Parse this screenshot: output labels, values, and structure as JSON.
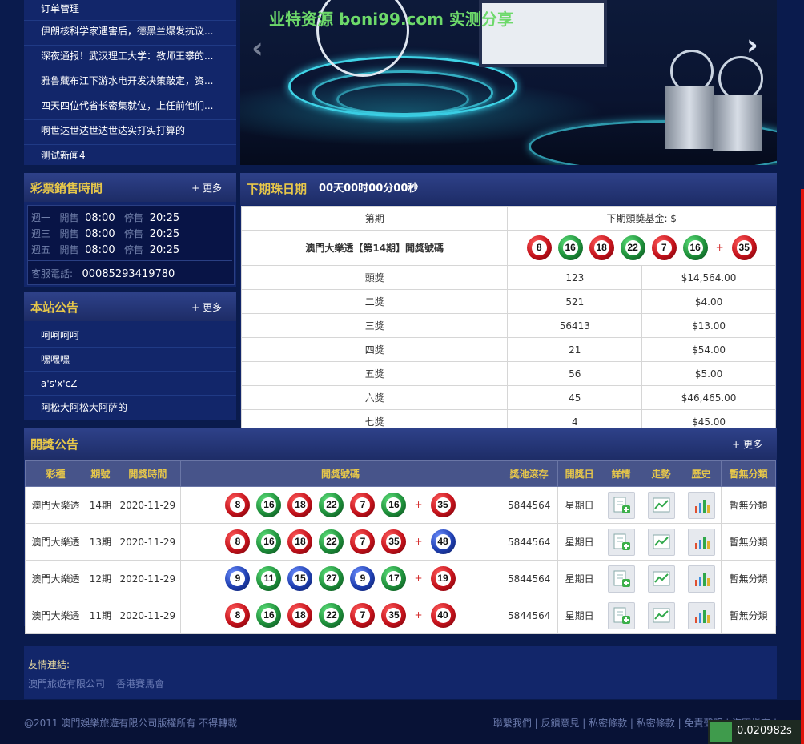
{
  "news": [
    "订单管理",
    "伊朗核科学家遇害后，德黑兰爆发抗议...",
    "深夜通报！武汉理工大学：教师王攀的...",
    "雅鲁藏布江下游水电开发决策敲定，资...",
    "四天四位代省长密集就位，上任前他们...",
    "啊世达世达世达世达实打实打算的",
    "测试新闻4"
  ],
  "banner": {
    "watermark": "业特资源 boni99.com 实测分享"
  },
  "sales": {
    "title": "彩票銷售時間",
    "more": "+ 更多",
    "rows": [
      {
        "day": "週一",
        "open_label": "開售",
        "open": "08:00",
        "close_label": "停售",
        "close": "20:25"
      },
      {
        "day": "週三",
        "open_label": "開售",
        "open": "08:00",
        "close_label": "停售",
        "close": "20:25"
      },
      {
        "day": "週五",
        "open_label": "開售",
        "open": "08:00",
        "close_label": "停售",
        "close": "20:25"
      }
    ],
    "phone_label": "客服電話:",
    "phone": "00085293419780"
  },
  "notice": {
    "title": "本站公告",
    "more": "+ 更多",
    "items": [
      "呵呵呵呵",
      "嘿嘿嘿",
      "a's'x'cZ",
      "阿松大阿松大阿萨的"
    ]
  },
  "nextdraw": {
    "title": "下期珠日期",
    "countdown": "00天00时00分00秒",
    "col_period": "第期",
    "jackpot_label": "下期頭獎基金: $",
    "draw_label": "澳門大樂透【第14期】開獎號碼",
    "balls": [
      {
        "n": "8",
        "c": "red"
      },
      {
        "n": "16",
        "c": "green"
      },
      {
        "n": "18",
        "c": "red"
      },
      {
        "n": "22",
        "c": "green"
      },
      {
        "n": "7",
        "c": "red"
      },
      {
        "n": "16",
        "c": "green"
      }
    ],
    "special": {
      "n": "35",
      "c": "red"
    },
    "plus": "+",
    "prizes": [
      {
        "name": "頭獎",
        "count": "123",
        "amount": "$14,564.00"
      },
      {
        "name": "二獎",
        "count": "521",
        "amount": "$4.00"
      },
      {
        "name": "三獎",
        "count": "56413",
        "amount": "$13.00"
      },
      {
        "name": "四獎",
        "count": "21",
        "amount": "$54.00"
      },
      {
        "name": "五獎",
        "count": "56",
        "amount": "$5.00"
      },
      {
        "name": "六獎",
        "count": "45",
        "amount": "$46,465.00"
      },
      {
        "name": "七獎",
        "count": "4",
        "amount": "$45.00"
      }
    ]
  },
  "draws": {
    "title": "開獎公告",
    "more": "+ 更多",
    "headers": [
      "彩種",
      "期號",
      "開獎時間",
      "開獎號碼",
      "獎池滾存",
      "開獎日",
      "詳情",
      "走勢",
      "歷史",
      "暫無分類"
    ],
    "plus": "+",
    "rows": [
      {
        "type": "澳門大樂透",
        "period": "14期",
        "date": "2020-11-29",
        "balls": [
          {
            "n": "8",
            "c": "red"
          },
          {
            "n": "16",
            "c": "green"
          },
          {
            "n": "18",
            "c": "red"
          },
          {
            "n": "22",
            "c": "green"
          },
          {
            "n": "7",
            "c": "red"
          },
          {
            "n": "16",
            "c": "green"
          }
        ],
        "special": {
          "n": "35",
          "c": "red"
        },
        "pool": "5844564",
        "weekday": "星期日",
        "category": "暫無分類"
      },
      {
        "type": "澳門大樂透",
        "period": "13期",
        "date": "2020-11-29",
        "balls": [
          {
            "n": "8",
            "c": "red"
          },
          {
            "n": "16",
            "c": "green"
          },
          {
            "n": "18",
            "c": "red"
          },
          {
            "n": "22",
            "c": "green"
          },
          {
            "n": "7",
            "c": "red"
          },
          {
            "n": "35",
            "c": "red"
          }
        ],
        "special": {
          "n": "48",
          "c": "blue"
        },
        "pool": "5844564",
        "weekday": "星期日",
        "category": "暫無分類"
      },
      {
        "type": "澳門大樂透",
        "period": "12期",
        "date": "2020-11-29",
        "balls": [
          {
            "n": "9",
            "c": "blue"
          },
          {
            "n": "11",
            "c": "green"
          },
          {
            "n": "15",
            "c": "blue"
          },
          {
            "n": "27",
            "c": "green"
          },
          {
            "n": "9",
            "c": "blue"
          },
          {
            "n": "17",
            "c": "green"
          }
        ],
        "special": {
          "n": "19",
          "c": "red"
        },
        "pool": "5844564",
        "weekday": "星期日",
        "category": "暫無分類"
      },
      {
        "type": "澳門大樂透",
        "period": "11期",
        "date": "2020-11-29",
        "balls": [
          {
            "n": "8",
            "c": "red"
          },
          {
            "n": "16",
            "c": "green"
          },
          {
            "n": "18",
            "c": "red"
          },
          {
            "n": "22",
            "c": "green"
          },
          {
            "n": "7",
            "c": "red"
          },
          {
            "n": "35",
            "c": "red"
          }
        ],
        "special": {
          "n": "40",
          "c": "red"
        },
        "pool": "5844564",
        "weekday": "星期日",
        "category": "暫無分類"
      }
    ]
  },
  "friends": {
    "label": "友情連結:",
    "links": [
      "澳門旅遊有限公司",
      "香港賽馬會"
    ]
  },
  "footer": {
    "copyright": "@2011 澳門娛樂旅遊有限公司版權所有 不得轉載",
    "links": "聯繫我們 | 反饋意見 | 私密條款 | 私密條款 | 免責聲明 | 海軍指南 |"
  },
  "timer": "0.020982s",
  "colors": {
    "accent_gold": "#e7c74a",
    "panel_bg": "#12266a",
    "page_bg": "#0a1b4d",
    "ball_red": "#c4121b",
    "ball_green": "#1e8f3a",
    "ball_blue": "#1f3fb1"
  }
}
